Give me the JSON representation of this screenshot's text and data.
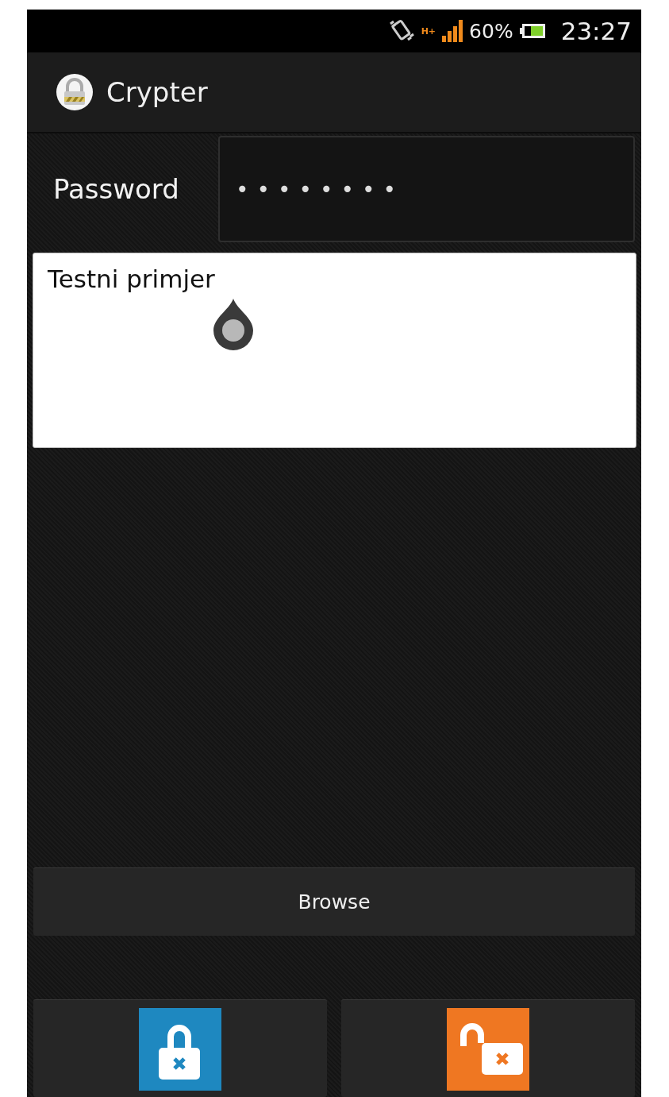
{
  "status_bar": {
    "network": "H+",
    "battery": "60%",
    "time": "23:27"
  },
  "app_bar": {
    "title": "Crypter"
  },
  "password": {
    "label": "Password",
    "value": "••••••••"
  },
  "message": {
    "value": "Testni primjer"
  },
  "browse_button": {
    "label": "Browse"
  },
  "actions": [
    {
      "kind": "lock"
    },
    {
      "kind": "unlock"
    }
  ]
}
